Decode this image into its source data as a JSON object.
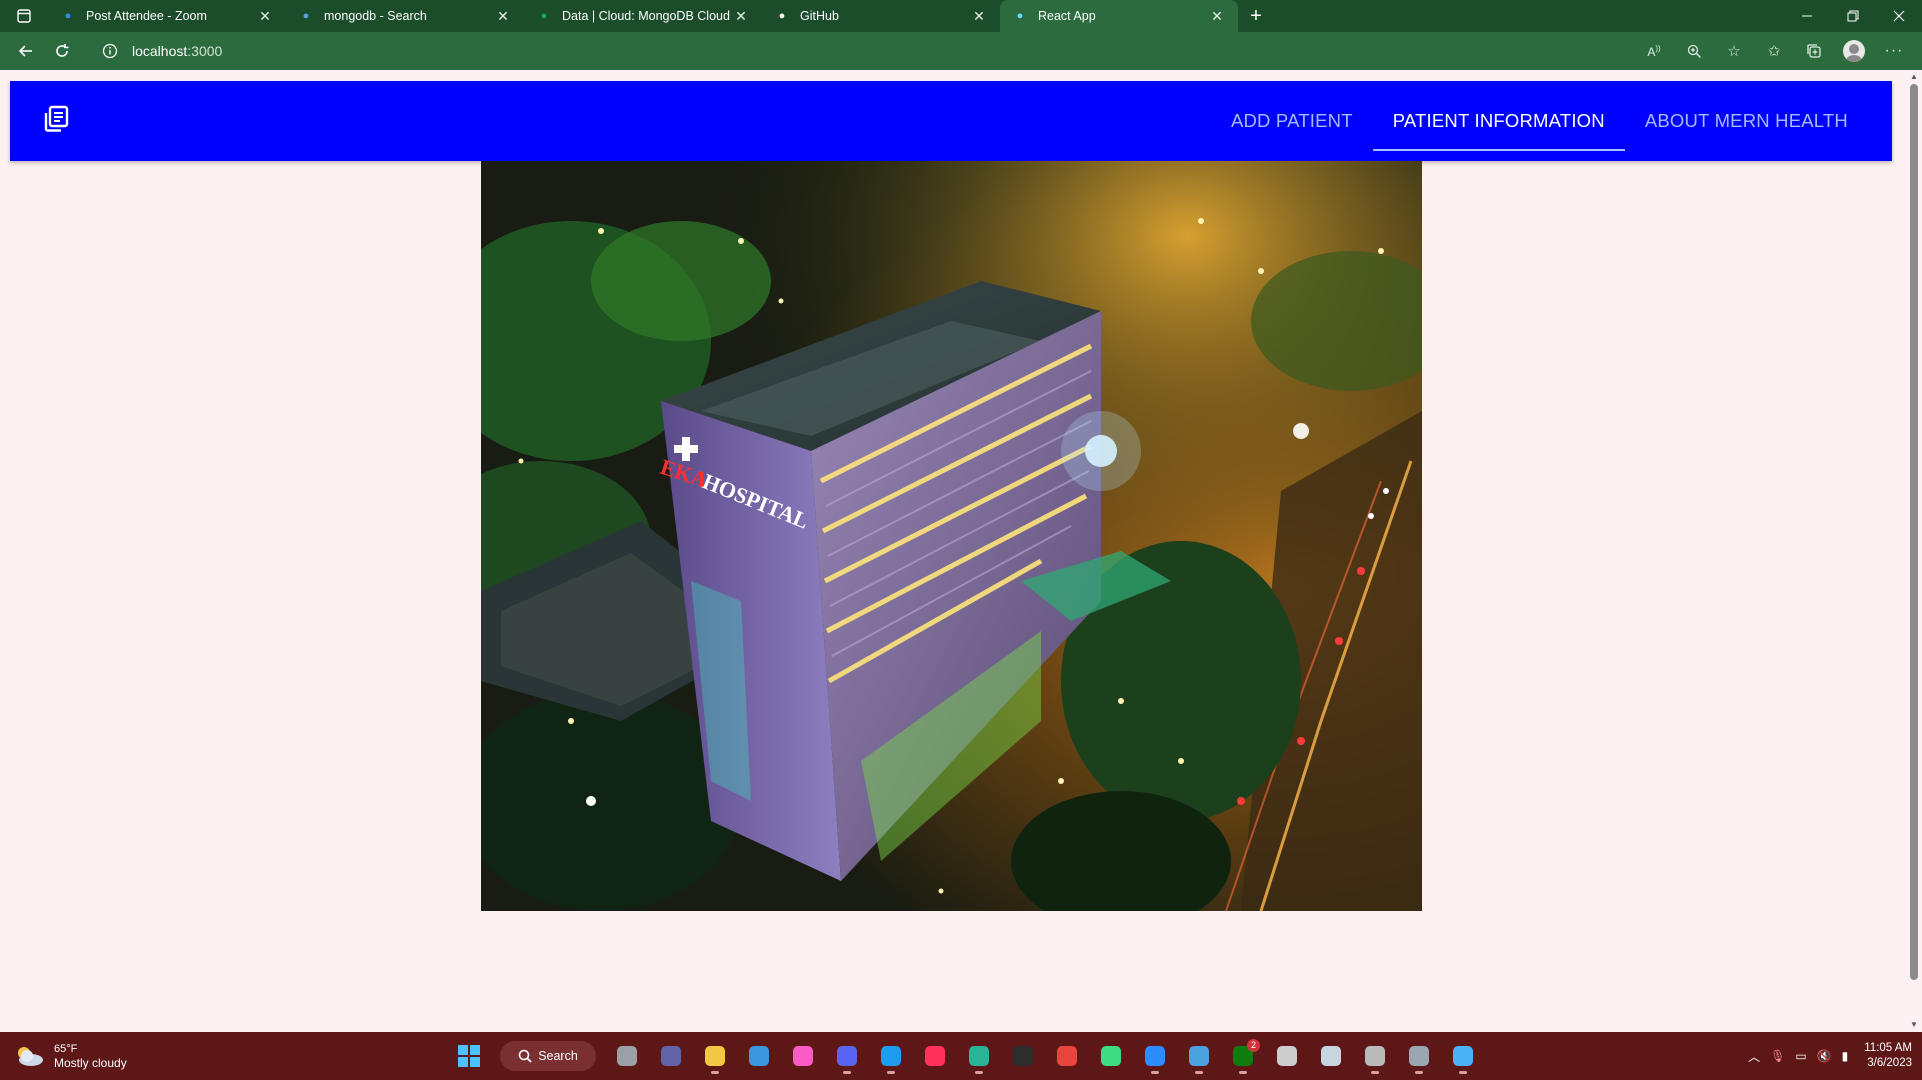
{
  "browser": {
    "tabs": [
      {
        "title": "Post Attendee - Zoom",
        "icon": "zoom-icon",
        "color": "#2d8cff"
      },
      {
        "title": "mongodb - Search",
        "icon": "search-icon",
        "color": "#5aa0e6"
      },
      {
        "title": "Data | Cloud: MongoDB Cloud",
        "icon": "mongodb-leaf-icon",
        "color": "#13aa52"
      },
      {
        "title": "GitHub",
        "icon": "github-icon",
        "color": "#ffffff"
      },
      {
        "title": "React App",
        "icon": "react-icon",
        "color": "#61dafb"
      }
    ],
    "active_tab_index": 4,
    "address": {
      "host": "localhost",
      "port": ":3000"
    }
  },
  "app": {
    "theme_color": "#0000ff",
    "nav": [
      {
        "label": "ADD PATIENT",
        "active": false
      },
      {
        "label": "PATIENT INFORMATION",
        "active": true
      },
      {
        "label": "ABOUT MERN HEALTH",
        "active": false
      }
    ],
    "hero": {
      "sign_text": "EKA HOSPITAL"
    }
  },
  "taskbar": {
    "weather": {
      "temp": "65°F",
      "condition": "Mostly cloudy"
    },
    "search_label": "Search",
    "apps": [
      {
        "name": "task-view-icon",
        "color": "#9aa0a6"
      },
      {
        "name": "teams-icon",
        "color": "#6264a7"
      },
      {
        "name": "file-explorer-icon",
        "color": "#f2c744"
      },
      {
        "name": "microsoft-store-icon",
        "color": "#3a96dd"
      },
      {
        "name": "itunes-icon",
        "color": "#fb5bc5"
      },
      {
        "name": "discord-icon",
        "color": "#5865f2"
      },
      {
        "name": "vscode-icon",
        "color": "#1f9cf0"
      },
      {
        "name": "intellij-icon",
        "color": "#fe315d"
      },
      {
        "name": "edge-icon",
        "color": "#2bb39a"
      },
      {
        "name": "terminal-icon",
        "color": "#2d2d2d"
      },
      {
        "name": "chrome-icon",
        "color": "#e8453c"
      },
      {
        "name": "android-studio-icon",
        "color": "#3ddc84"
      },
      {
        "name": "zoom-app-icon",
        "color": "#2d8cff"
      },
      {
        "name": "notepad-icon",
        "color": "#4aa3df"
      },
      {
        "name": "xbox-icon",
        "color": "#107c10"
      },
      {
        "name": "gog-icon",
        "color": "#cccccc"
      },
      {
        "name": "steam-icon",
        "color": "#c7d5e0"
      },
      {
        "name": "game-app-icon",
        "color": "#bbbbbb"
      },
      {
        "name": "settings-icon",
        "color": "#9aa7b0"
      },
      {
        "name": "paint-app-icon",
        "color": "#4ab2f5"
      }
    ],
    "xbox_badge": "2",
    "clock": {
      "time": "11:05 AM",
      "date": "3/6/2023"
    }
  }
}
